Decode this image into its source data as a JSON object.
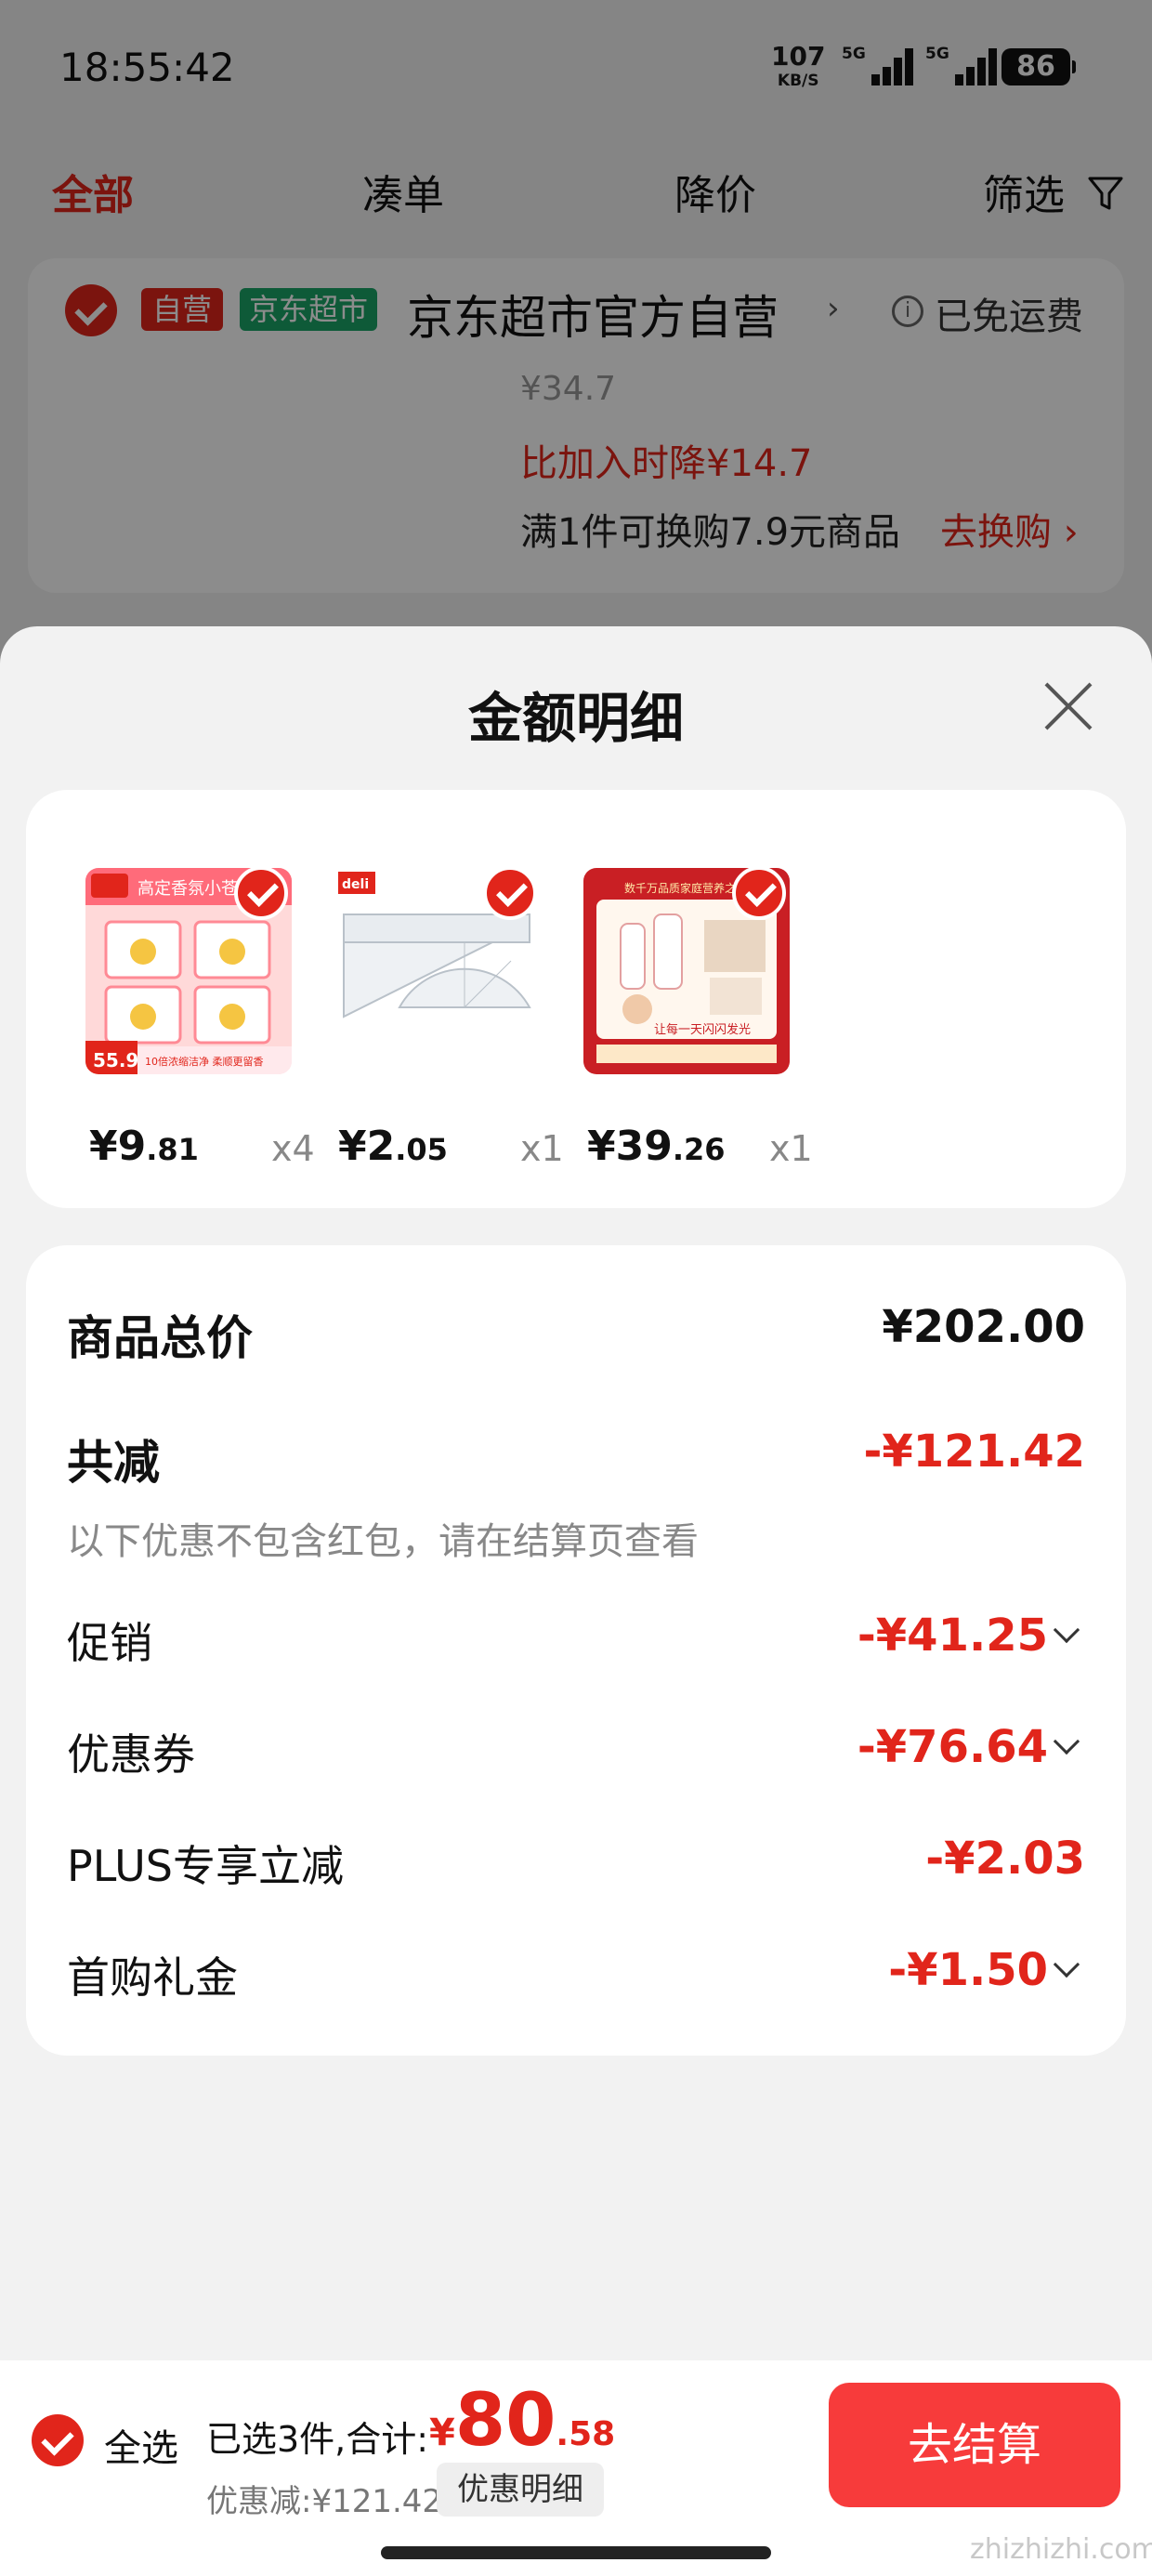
{
  "status_bar": {
    "time": "18:55:42",
    "net_speed": "107",
    "net_unit": "KB/S",
    "signal_label": "5G",
    "battery": "86"
  },
  "tabs": [
    "全部",
    "凑单",
    "降价",
    "筛选"
  ],
  "store": {
    "tag_self": "自营",
    "tag_market": "京东超市",
    "name": "京东超市官方自营",
    "free_shipping": "已免运费",
    "orig_price": "¥34.7",
    "price_drop": "比加入时降¥14.7",
    "swap_text": "满1件可换购7.9元商品",
    "swap_link": "去换购 ›"
  },
  "sheet": {
    "title": "金额明细",
    "products": [
      {
        "price_int": "¥9",
        "price_dec": ".81",
        "qty": "x4",
        "thumb_text": "高定香氛小苍兰",
        "badge": "55.9",
        "caption": "10倍浓缩洁净 柔顺更留香"
      },
      {
        "price_int": "¥2",
        "price_dec": ".05",
        "qty": "x1",
        "thumb_text": "deli"
      },
      {
        "price_int": "¥39",
        "price_dec": ".26",
        "qty": "x1",
        "thumb_text": "数千万品质家庭营养之选",
        "caption": "让每一天闪闪发光"
      }
    ],
    "summary": {
      "total_label": "商品总价",
      "total_value": "¥202.00",
      "reduce_label": "共减",
      "reduce_value": "-¥121.42",
      "note": "以下优惠不包含红包，请在结算页查看",
      "rows": [
        {
          "label": "促销",
          "value": "-¥41.25"
        },
        {
          "label": "优惠券",
          "value": "-¥76.64"
        },
        {
          "label": "PLUS专享立减",
          "value": "-¥2.03"
        },
        {
          "label": "首购礼金",
          "value": "-¥1.50"
        }
      ]
    }
  },
  "bottom": {
    "select_all": "全选",
    "selected": "已选3件,合计:",
    "total_sym": "¥",
    "total_int": "80",
    "total_dec": ".58",
    "discount": "优惠减:¥121.42",
    "detail_btn": "优惠明细",
    "checkout": "去结算",
    "watermark": "zhizhizhi.com"
  },
  "colors": {
    "accent": "#e1251b",
    "checkout": "#f73b3b",
    "market_green": "#1aa466"
  }
}
